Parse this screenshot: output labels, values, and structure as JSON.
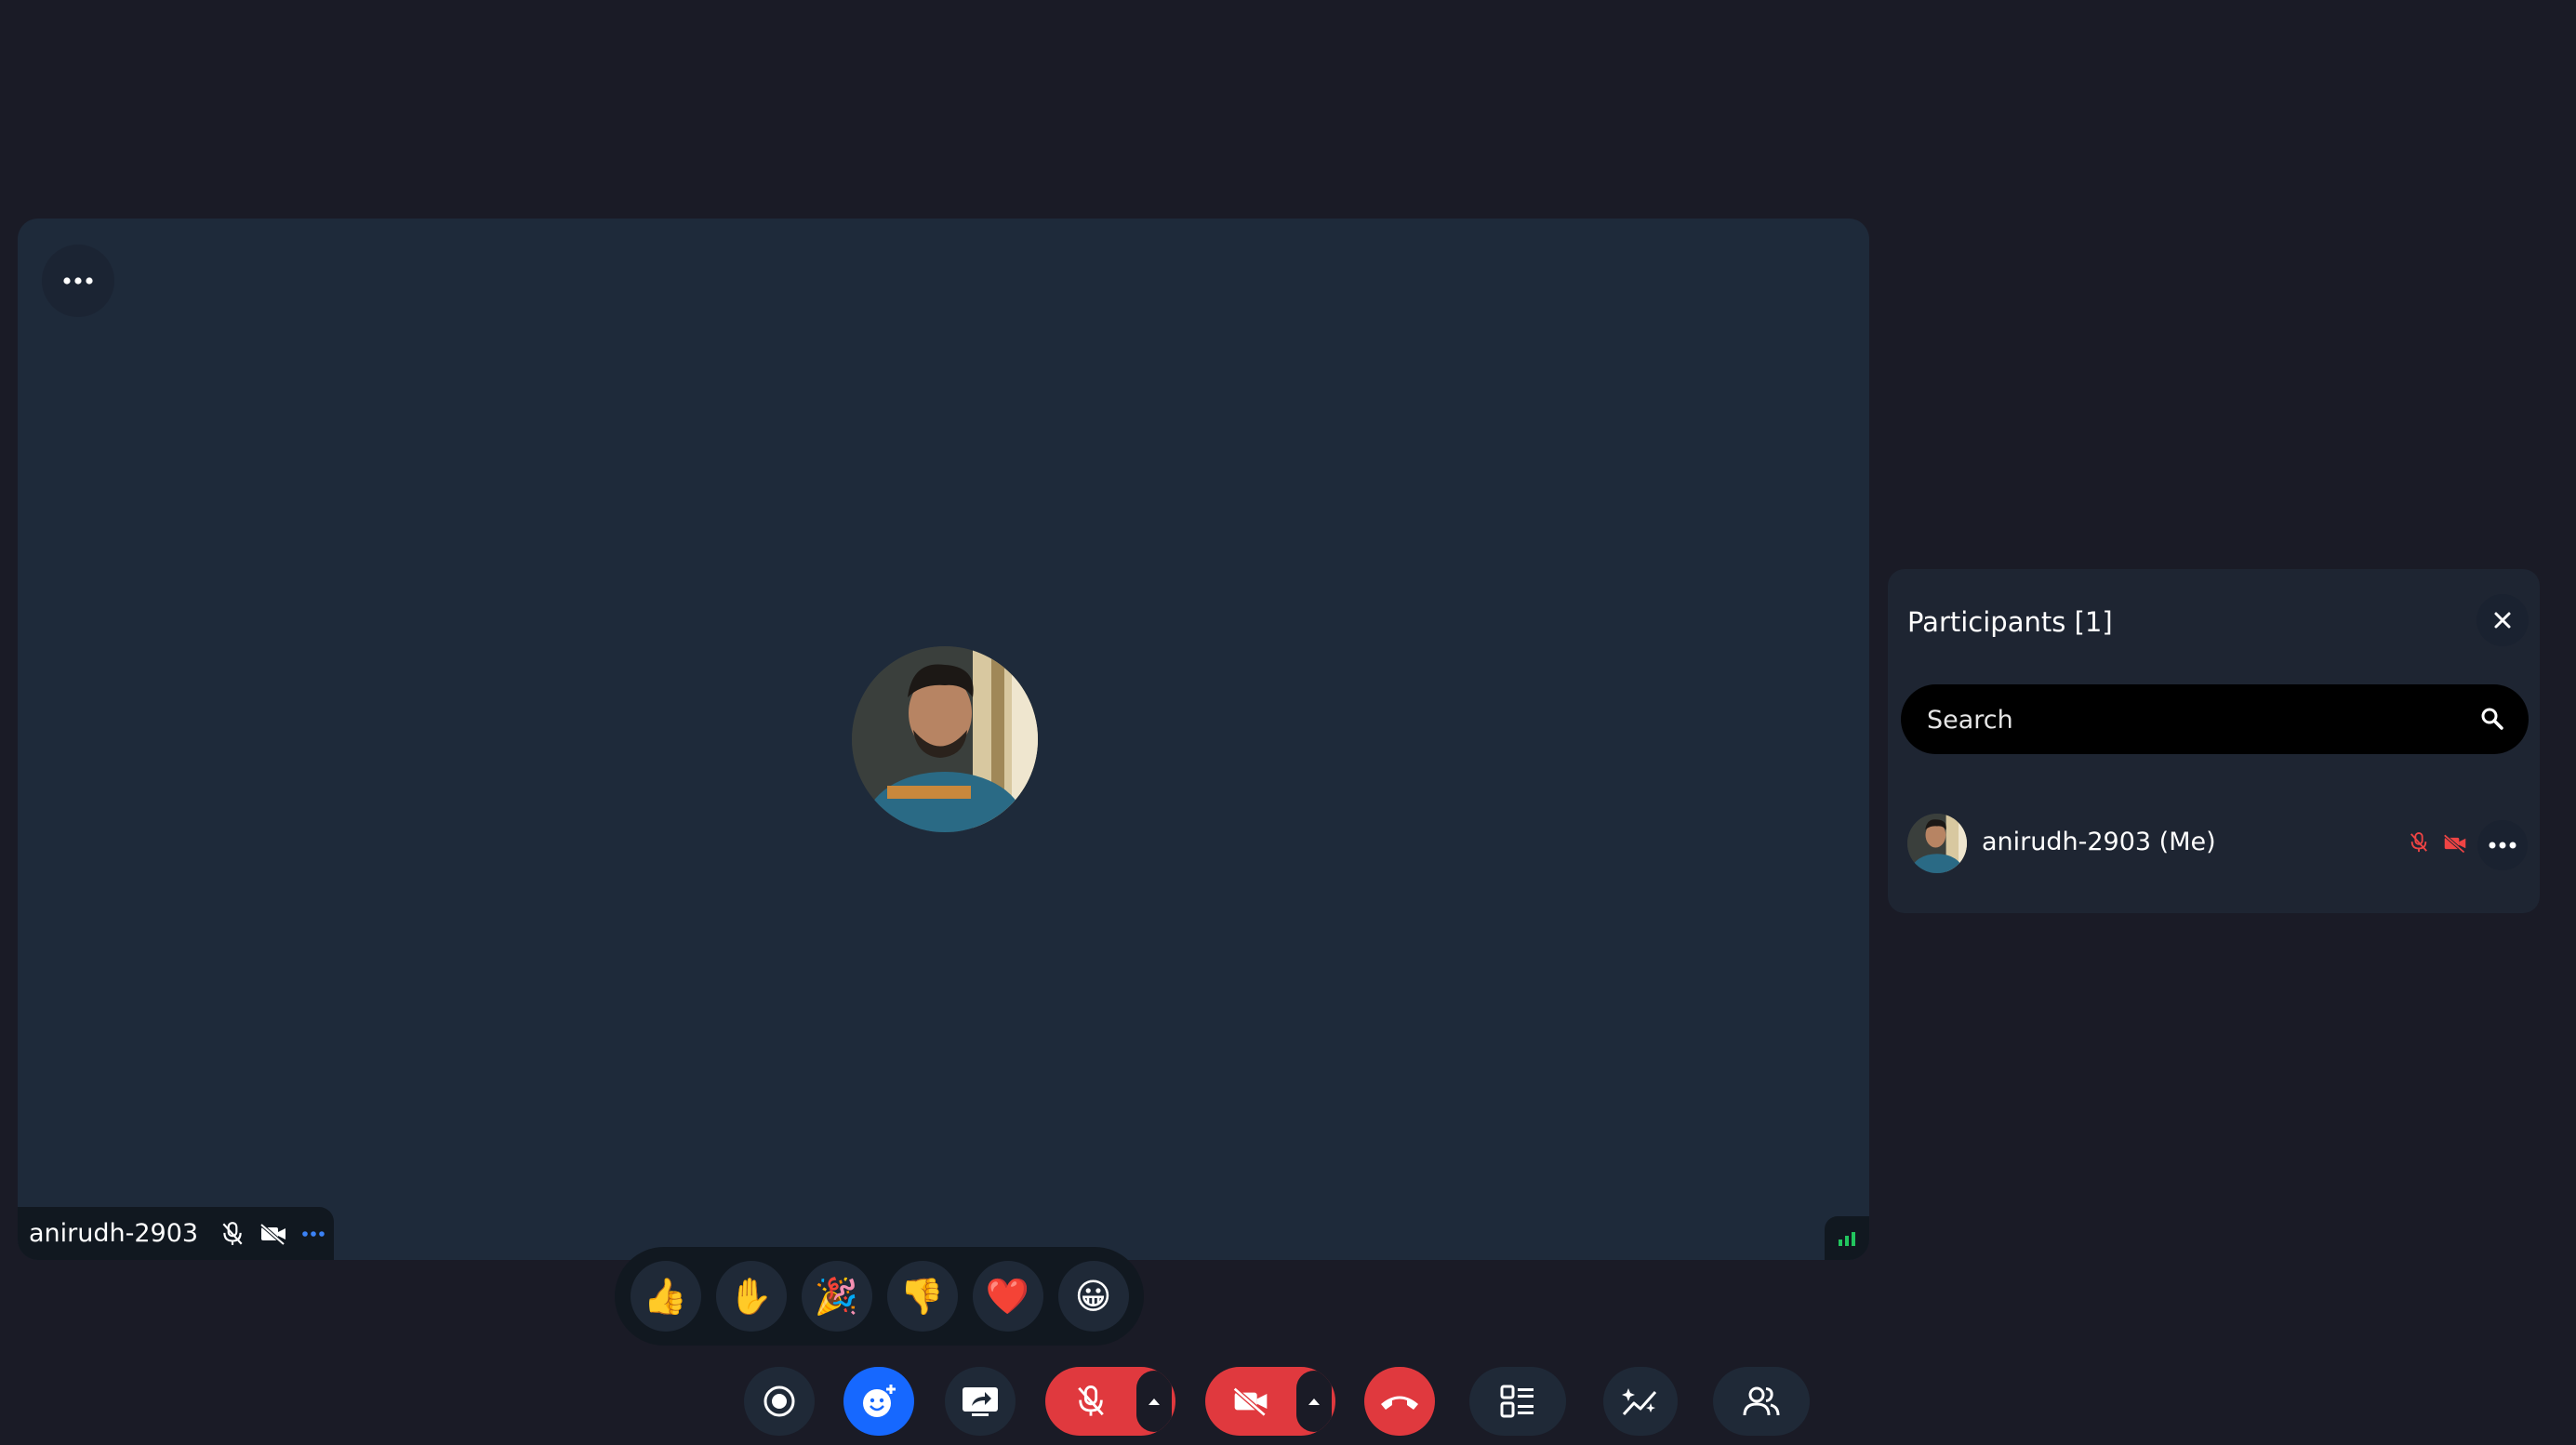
{
  "colors": {
    "background": "#1a1b26",
    "tile": "#1e2a3a",
    "danger": "#e0393e",
    "accent": "#1668ff",
    "signal": "#22c55e"
  },
  "stage": {
    "participant_name": "anirudh-2903",
    "menu_icon": "more-horizontal-icon",
    "signal_icon": "signal-strength-icon"
  },
  "reactions": [
    {
      "name": "thumbs-up",
      "emoji": "👍"
    },
    {
      "name": "raised-hand",
      "emoji": "✋"
    },
    {
      "name": "party-popper",
      "emoji": "🎉"
    },
    {
      "name": "thumbs-down",
      "emoji": "👎"
    },
    {
      "name": "heart",
      "emoji": "❤️"
    },
    {
      "name": "grinning-face",
      "emoji": "😀"
    }
  ],
  "controls": [
    {
      "name": "record",
      "icon": "record-icon"
    },
    {
      "name": "reactions",
      "icon": "emoji-add-icon",
      "active": true
    },
    {
      "name": "share-screen",
      "icon": "screen-share-icon"
    },
    {
      "name": "microphone",
      "icon": "mic-off-icon",
      "state": "off"
    },
    {
      "name": "camera",
      "icon": "video-off-icon",
      "state": "off"
    },
    {
      "name": "leave",
      "icon": "phone-hangup-icon"
    },
    {
      "name": "layout",
      "icon": "layout-list-icon"
    },
    {
      "name": "effects",
      "icon": "sparkle-chart-icon"
    },
    {
      "name": "participants",
      "icon": "users-icon"
    }
  ],
  "participants_panel": {
    "title": "Participants [1]",
    "search": {
      "placeholder": "Search"
    },
    "items": [
      {
        "name": "anirudh-2903 (Me)",
        "mic": "off",
        "camera": "off"
      }
    ]
  }
}
